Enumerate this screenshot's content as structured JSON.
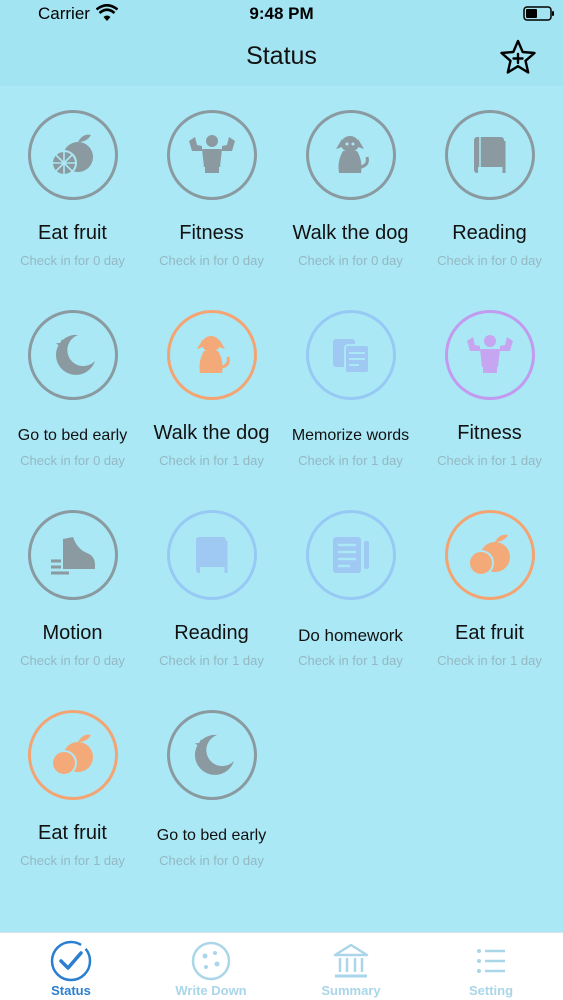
{
  "status_bar": {
    "carrier": "Carrier",
    "time": "9:48 PM"
  },
  "nav": {
    "title": "Status",
    "star_icon": "star-plus-icon"
  },
  "colors": {
    "background": "#aae8f5",
    "ring_grey": "#8a9aa0",
    "ring_orange": "#f3a472",
    "ring_blue": "#97c9f5",
    "ring_purple": "#c29af0",
    "tab_active": "#2b7fd0"
  },
  "habits": [
    {
      "title": "Eat fruit",
      "subtitle": "Check in for 0 day",
      "icon": "fruit-icon"
    },
    {
      "title": "Fitness",
      "subtitle": "Check in for 0 day",
      "icon": "muscle-icon"
    },
    {
      "title": "Walk the dog",
      "subtitle": "Check in for 0 day",
      "icon": "dog-icon"
    },
    {
      "title": "Reading",
      "subtitle": "Check in for 0 day",
      "icon": "book-icon"
    },
    {
      "title": "Go to bed early",
      "subtitle": "Check in for 0 day",
      "icon": "moon-icon"
    },
    {
      "title": "Walk the dog",
      "subtitle": "Check in for 1 day",
      "icon": "dog-icon"
    },
    {
      "title": "Memorize words",
      "subtitle": "Check in for 1 day",
      "icon": "flashcards-icon"
    },
    {
      "title": "Fitness",
      "subtitle": "Check in for 1 day",
      "icon": "muscle-icon"
    },
    {
      "title": "Motion",
      "subtitle": "Check in for 0 day",
      "icon": "shoe-icon"
    },
    {
      "title": "Reading",
      "subtitle": "Check in for 1 day",
      "icon": "book-icon"
    },
    {
      "title": "Do homework",
      "subtitle": "Check in for 1 day",
      "icon": "homework-icon"
    },
    {
      "title": "Eat fruit",
      "subtitle": "Check in for 1 day",
      "icon": "fruit-icon"
    },
    {
      "title": "Eat fruit",
      "subtitle": "Check in for 1 day",
      "icon": "fruit-icon"
    },
    {
      "title": "Go to bed early",
      "subtitle": "Check in for 0 day",
      "icon": "moon-icon"
    }
  ],
  "tabs": [
    {
      "label": "Status",
      "icon": "check-circle-icon",
      "active": true
    },
    {
      "label": "Write Down",
      "icon": "cookie-icon",
      "active": false
    },
    {
      "label": "Summary",
      "icon": "bank-icon",
      "active": false
    },
    {
      "label": "Setting",
      "icon": "list-icon",
      "active": false
    }
  ]
}
